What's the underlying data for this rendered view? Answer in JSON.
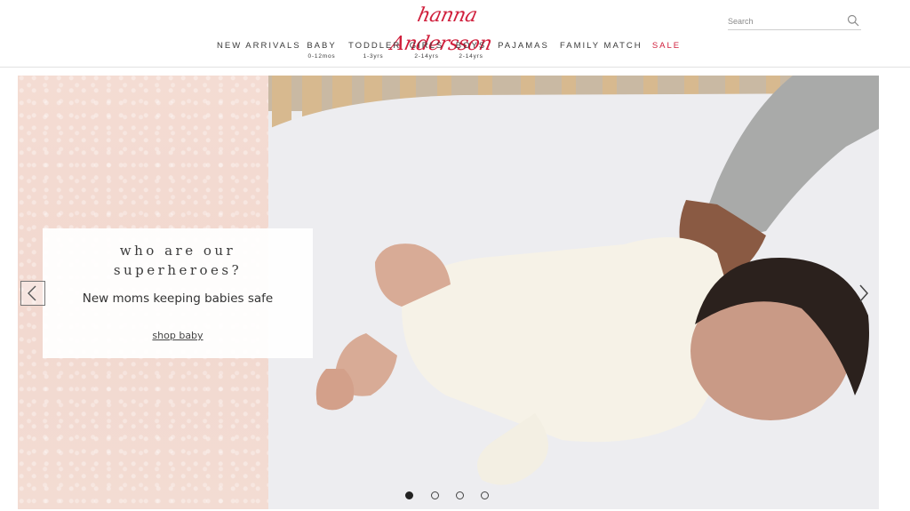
{
  "brand": {
    "logo_text": "hanna Andersson",
    "color": "#d01f3c"
  },
  "search": {
    "placeholder": "Search",
    "value": ""
  },
  "nav": {
    "items": [
      {
        "label": "NEW ARRIVALS",
        "sub": ""
      },
      {
        "label": "BABY",
        "sub": "0-12mos"
      },
      {
        "label": "TODDLER",
        "sub": "1-3yrs"
      },
      {
        "label": "GIRLS",
        "sub": "2-14yrs"
      },
      {
        "label": "BOYS",
        "sub": "2-14yrs"
      },
      {
        "label": "PAJAMAS",
        "sub": ""
      },
      {
        "label": "FAMILY MATCH",
        "sub": ""
      },
      {
        "label": "SALE",
        "sub": "",
        "color": "#d01f3c"
      }
    ]
  },
  "hero": {
    "headline": "who are our\nsuperheroes?",
    "subheadline": "New moms keeping babies safe",
    "cta_label": "shop baby",
    "background_color": "#f3dad1",
    "slides": {
      "count": 4,
      "active": 1
    }
  },
  "icons": {
    "search": "search-icon",
    "prev": "chevron-left-icon",
    "next": "chevron-right-icon"
  }
}
